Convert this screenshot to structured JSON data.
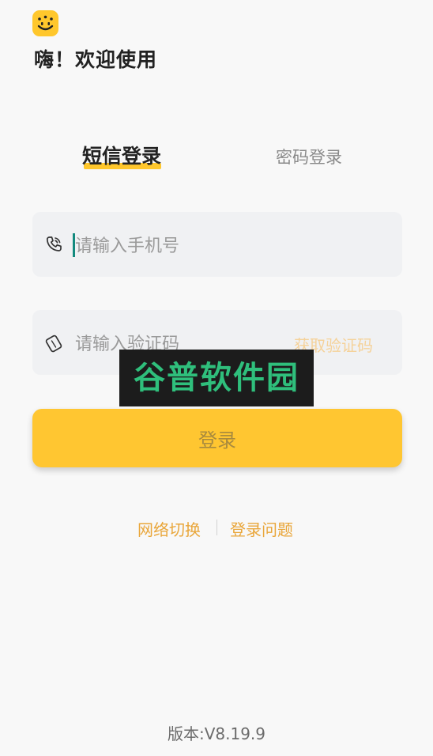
{
  "header": {
    "logo_icon": "smiley-crown-icon",
    "greeting": "嗨！欢迎使用"
  },
  "tabs": {
    "sms_login": "短信登录",
    "password_login": "密码登录",
    "active": "sms_login"
  },
  "form": {
    "phone": {
      "icon": "phone-icon",
      "placeholder": "请输入手机号",
      "value": ""
    },
    "code": {
      "icon": "shield-code-icon",
      "placeholder": "请输入验证码",
      "value": "",
      "get_code_label": "获取验证码"
    },
    "login_label": "登录"
  },
  "watermark": {
    "text": "谷普软件园"
  },
  "links": {
    "network_switch": "网络切换",
    "login_problem": "登录问题"
  },
  "footer": {
    "version": "版本:V8.19.9"
  },
  "colors": {
    "accent": "#ffc631",
    "link": "#e9a63a",
    "get_code_disabled": "#f5d29a",
    "cursor": "#138a7e",
    "background": "#f8f8f8",
    "field_background": "#f0f1f3"
  }
}
